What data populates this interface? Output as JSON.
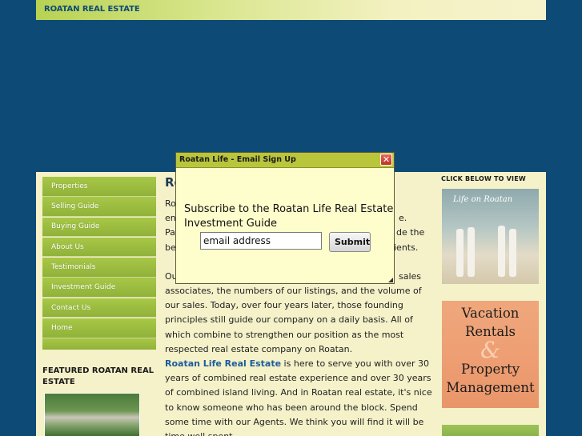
{
  "header": {
    "site_title": "ROATAN REAL ESTATE"
  },
  "sidebar": {
    "nav_items": [
      {
        "label": "Properties"
      },
      {
        "label": "Selling Guide"
      },
      {
        "label": "Buying Guide"
      },
      {
        "label": "About Us"
      },
      {
        "label": "Testimonials"
      },
      {
        "label": "Investment Guide"
      },
      {
        "label": "Contact Us"
      },
      {
        "label": "Home"
      }
    ],
    "featured_title": "FEATURED ROATAN REAL ESTATE"
  },
  "main": {
    "heading_fragment": "Ro",
    "para1_lines": [
      "Ro",
      "en",
      "Pa",
      "be"
    ],
    "para1_right_fragments": [
      "e.",
      "de the",
      "ients."
    ],
    "para2_start": "Ou",
    "para2_end_fragment": "sales",
    "para2_rest": "associates, the numbers of our listings, and the volume of our sales. Today, over four years later, those founding principles still guide our company on a daily basis. All of which combine to strengthen our position as the most respected real estate company on Roatan.",
    "para3_link": "Roatan Life Real Estate",
    "para3_rest": " is here to serve you with over 30 years of combined real estate experience and over 30 years of combined island living. And in Roatan real estate, it's nice to know someone who has been around the block. Spend some time with our Agents. We think you will find it will be time well spent."
  },
  "right_sidebar": {
    "click_label": "CLICK BELOW TO VIEW",
    "life_banner_text": "Life on Roatan",
    "vacation_lines": [
      "Vacation",
      "Rentals",
      "&",
      "Property",
      "Management"
    ]
  },
  "popup": {
    "title": "Roatan Life - Email Sign Up",
    "close_glyph": "✕",
    "heading": "Subscribe to the Roatan Life Real Estate Investment Guide",
    "email_value": "email address",
    "submit_label": "Submit"
  }
}
